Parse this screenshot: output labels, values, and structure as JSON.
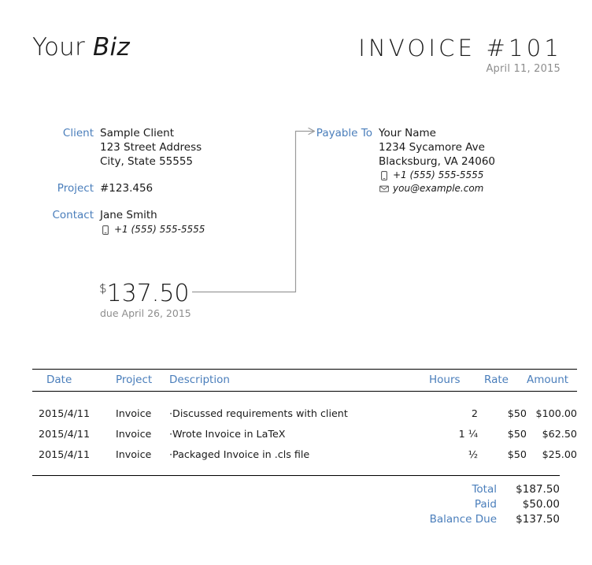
{
  "header": {
    "logo_primary": "Your",
    "logo_secondary": "Biz",
    "invoice_title": "INVOICE #101",
    "invoice_date": "April 11, 2015"
  },
  "colors": {
    "accent_blue": "#4a7ebb",
    "muted_gray": "#8d8d8d",
    "text_black": "#1a1a1a"
  },
  "client_block": {
    "client_label": "Client",
    "client_name": "Sample Client",
    "client_address_1": "123 Street Address",
    "client_address_2": "City, State 55555",
    "project_label": "Project",
    "project_value": "#123.456",
    "contact_label": "Contact",
    "contact_name": "Jane Smith",
    "contact_phone": "+1 (555) 555-5555",
    "phone_icon": "mobile-phone-icon"
  },
  "payable_block": {
    "payable_label": "Payable To",
    "payee_name": "Your Name",
    "payee_address_1": "1234 Sycamore Ave",
    "payee_address_2": "Blacksburg, VA 24060",
    "payee_phone": "+1 (555) 555-5555",
    "payee_email": "you@example.com",
    "phone_icon": "mobile-phone-icon",
    "email_icon": "envelope-icon",
    "arrow_icon": "arrow-right-icon"
  },
  "amount_due": {
    "currency_symbol": "$",
    "amount": "137.50",
    "due_text": "due April 26, 2015"
  },
  "table": {
    "columns": [
      "Date",
      "Project",
      "Description",
      "Hours",
      "Rate",
      "Amount"
    ],
    "rows": [
      {
        "date": "2015/4/11",
        "project": "Invoice",
        "description": "Discussed requirements with client",
        "hours": "2",
        "rate": "$50",
        "amount": "$100.00"
      },
      {
        "date": "2015/4/11",
        "project": "Invoice",
        "description": "Wrote Invoice in LaTeX",
        "hours": "1 ¼",
        "rate": "$50",
        "amount": "$62.50"
      },
      {
        "date": "2015/4/11",
        "project": "Invoice",
        "description": "Packaged Invoice in .cls file",
        "hours": "½",
        "rate": "$50",
        "amount": "$25.00"
      }
    ],
    "bullet": "·"
  },
  "totals": {
    "rows": [
      {
        "label": "Total",
        "value": "$187.50"
      },
      {
        "label": "Paid",
        "value": "$50.00"
      },
      {
        "label": "Balance Due",
        "value": "$137.50"
      }
    ]
  }
}
